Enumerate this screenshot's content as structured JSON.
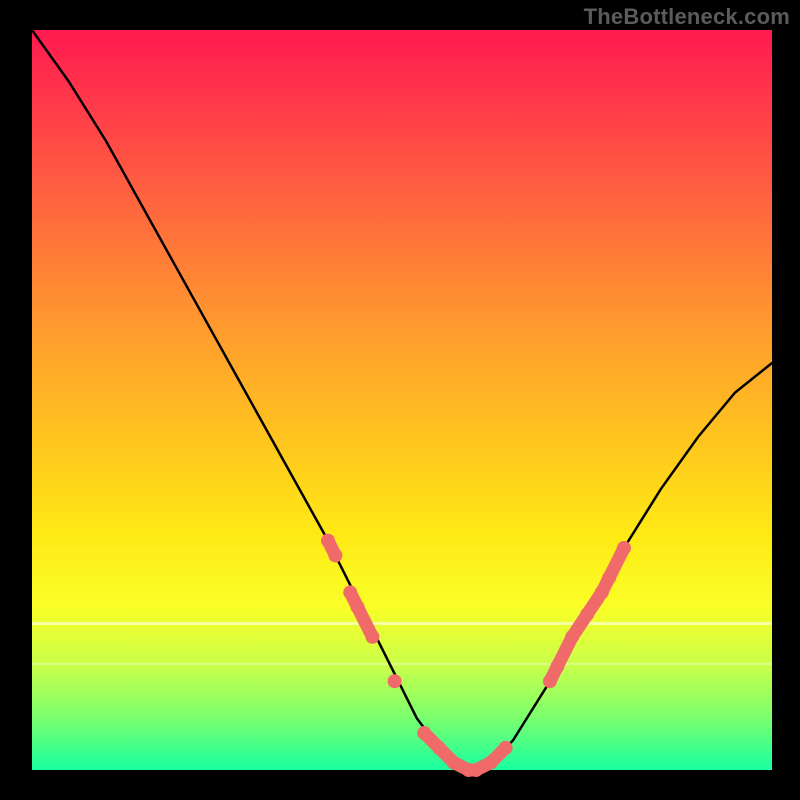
{
  "watermark": "TheBottleneck.com",
  "colors": {
    "page_bg": "#000000",
    "curve": "#000000",
    "marker": "#f06a6a",
    "gradient_top": "#ff1a4f",
    "gradient_bottom": "#18ffa0"
  },
  "chart_data": {
    "type": "line",
    "title": "",
    "xlabel": "",
    "ylabel": "",
    "xlim": [
      0,
      100
    ],
    "ylim": [
      0,
      100
    ],
    "x": [
      0,
      5,
      10,
      15,
      20,
      25,
      30,
      35,
      40,
      45,
      50,
      52,
      55,
      58,
      60,
      62,
      65,
      70,
      75,
      80,
      85,
      90,
      95,
      100
    ],
    "values": [
      100,
      93,
      85,
      76,
      67,
      58,
      49,
      40,
      31,
      21,
      11,
      7,
      3,
      1,
      0,
      1,
      4,
      12,
      21,
      30,
      38,
      45,
      51,
      55
    ],
    "marker_points": [
      {
        "x": 40,
        "y": 31
      },
      {
        "x": 41,
        "y": 29
      },
      {
        "x": 43,
        "y": 24
      },
      {
        "x": 44,
        "y": 22
      },
      {
        "x": 46,
        "y": 18
      },
      {
        "x": 49,
        "y": 12
      },
      {
        "x": 53,
        "y": 5
      },
      {
        "x": 55,
        "y": 3
      },
      {
        "x": 57,
        "y": 1
      },
      {
        "x": 59,
        "y": 0
      },
      {
        "x": 60,
        "y": 0
      },
      {
        "x": 62,
        "y": 1
      },
      {
        "x": 64,
        "y": 3
      },
      {
        "x": 70,
        "y": 12
      },
      {
        "x": 71,
        "y": 14
      },
      {
        "x": 73,
        "y": 18
      },
      {
        "x": 75,
        "y": 21
      },
      {
        "x": 77,
        "y": 24
      },
      {
        "x": 78,
        "y": 26
      },
      {
        "x": 80,
        "y": 30
      }
    ],
    "legend": [],
    "grid": false
  }
}
